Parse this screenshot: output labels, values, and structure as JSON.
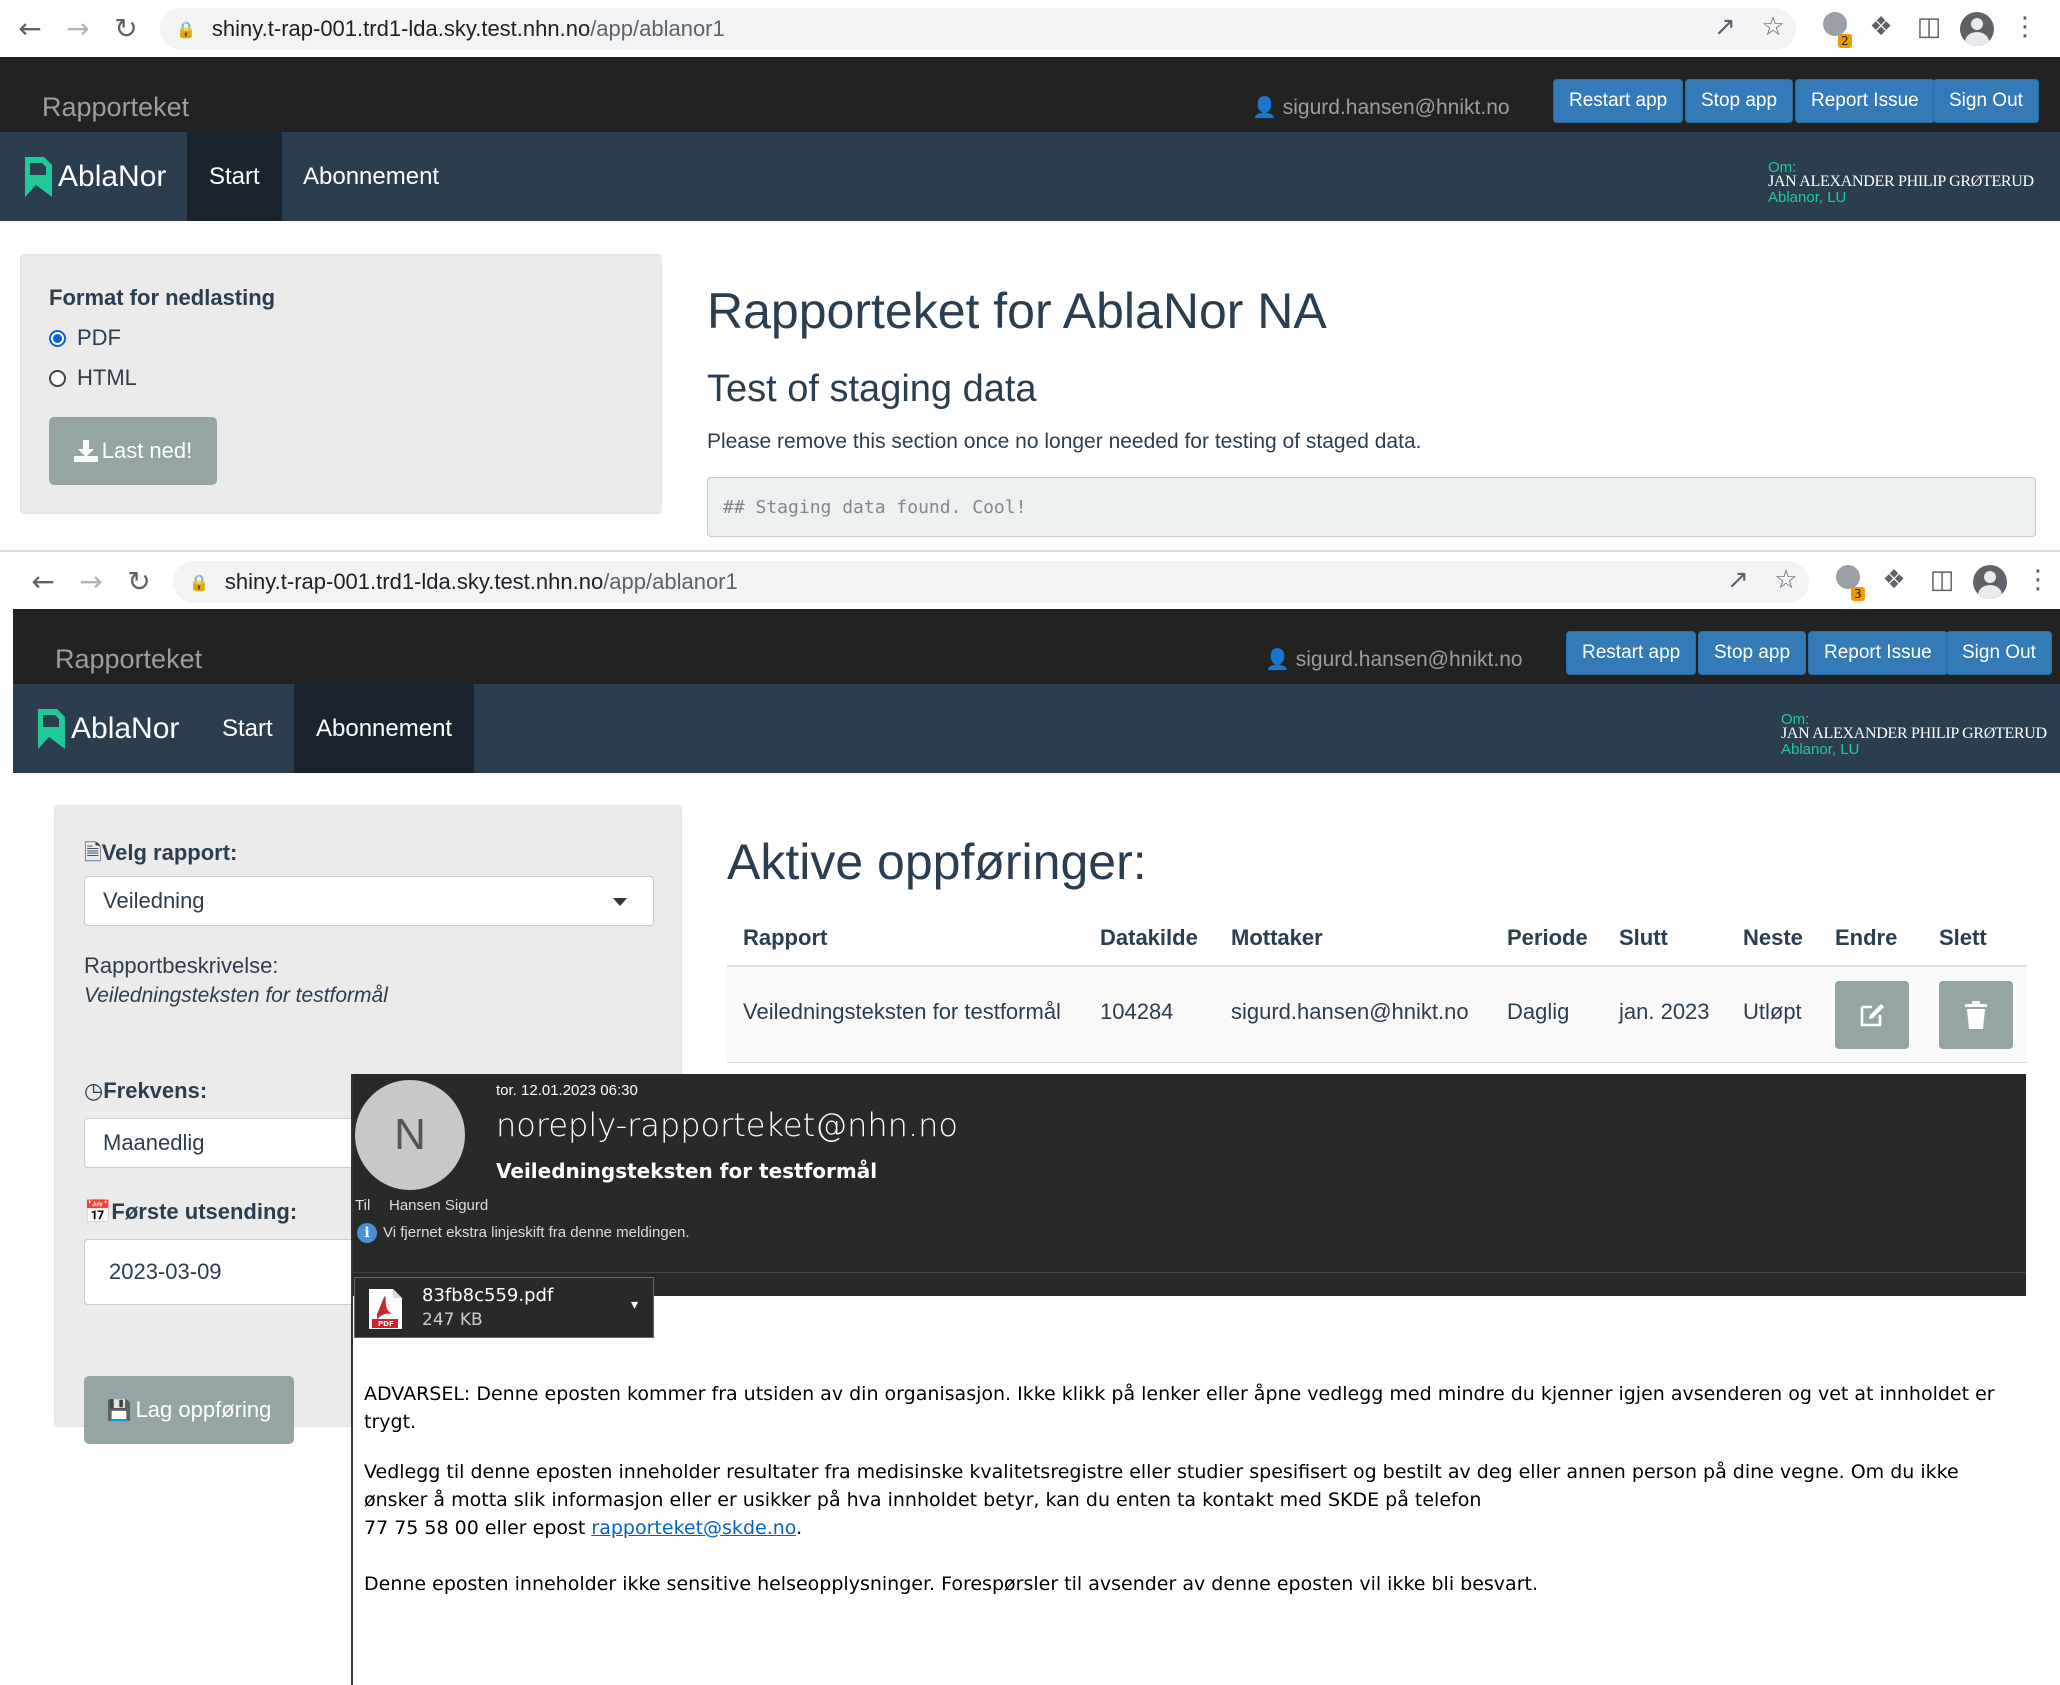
{
  "browser1": {
    "url_host": "shiny.t-rap-001.trd1-lda.sky.test.nhn.no",
    "url_path": "/app/ablanor1",
    "ext_badge": "2"
  },
  "browser2": {
    "url_host": "shiny.t-rap-001.trd1-lda.sky.test.nhn.no",
    "url_path": "/app/ablanor1",
    "ext_badge": "3"
  },
  "topbar": {
    "brand": "Rapporteket",
    "user": "sigurd.hansen@hnikt.no",
    "buttons": [
      "Restart app",
      "Stop app",
      "Report Issue",
      "Sign Out"
    ]
  },
  "appnav": {
    "app_name": "AblaNor",
    "tabs": [
      "Start",
      "Abonnement"
    ],
    "om_label": "Om:",
    "user_name": "JAN ALEXANDER PHILIP GRØTERUD",
    "org": "Ablanor, LU"
  },
  "start": {
    "format_label": "Format for nedlasting",
    "options": [
      "PDF",
      "HTML"
    ],
    "selected": "PDF",
    "download_button": "Last ned!",
    "title": "Rapporteket for AblaNor NA",
    "subtitle": "Test of staging data",
    "paragraph": "Please remove this section once no longer needed for testing of staged data.",
    "code": "## Staging data found. Cool!"
  },
  "abonnement": {
    "velg_label": "Velg rapport:",
    "velg_value": "Veiledning",
    "desc_label": "Rapportbeskrivelse:",
    "desc_value": "Veiledningsteksten for testformål",
    "freq_label": "Frekvens:",
    "freq_value": "Maanedlig",
    "first_label": "Første utsending:",
    "first_value": "2023-03-09",
    "create_button": "Lag oppføring",
    "table_title": "Aktive oppføringer:",
    "columns": [
      "Rapport",
      "Datakilde",
      "Mottaker",
      "Periode",
      "Slutt",
      "Neste",
      "Endre",
      "Slett"
    ],
    "rows": [
      {
        "rapport": "Veiledningsteksten for testformål",
        "datakilde": "104284",
        "mottaker": "sigurd.hansen@hnikt.no",
        "periode": "Daglig",
        "slutt": "jan. 2023",
        "neste": "Utløpt"
      }
    ]
  },
  "email": {
    "avatar_letter": "N",
    "date": "tor. 12.01.2023 06:30",
    "from": "noreply-rapporteket@nhn.no",
    "subject": "Veiledningsteksten for testformål",
    "to_label": "Til",
    "to": "Hansen Sigurd",
    "info": "Vi fjernet ekstra linjeskift fra denne meldingen.",
    "attachment_name": "83fb8c559.pdf",
    "attachment_size": "247 KB",
    "pdf_label": "PDF",
    "warning": "ADVARSEL: Denne eposten kommer fra utsiden av din organisasjon. Ikke klikk på lenker eller åpne vedlegg med mindre du kjenner igjen avsenderen og vet at innholdet er trygt.",
    "body1": "Vedlegg til denne eposten inneholder resultater fra medisinske kvalitetsregistre eller studier spesifisert og bestilt av deg eller annen person på dine vegne. Om du ikke ønsker å motta slik informasjon eller er usikker på hva innholdet betyr, kan du enten ta kontakt med SKDE på telefon",
    "body2_prefix": "77 75 58 00 eller epost ",
    "body2_link": "rapporteket@skde.no",
    "body2_suffix": ".",
    "body3": "Denne eposten inneholder ikke sensitive helseopplysninger. Forespørsler til avsender av denne eposten vil ikke bli besvart."
  },
  "colors": {
    "navbar_dark": "#222222",
    "app_nav": "#2b3e50",
    "primary_button": "#337ab7",
    "grey_button": "#95a5a6",
    "accent_teal": "#20c997"
  },
  "icons": [
    "back-icon",
    "forward-icon",
    "reload-icon",
    "lock-icon",
    "share-icon",
    "star-icon",
    "extension-icon",
    "puzzle-icon",
    "sidepanel-icon",
    "profile-icon",
    "menu-icon",
    "user-icon",
    "download-icon",
    "file-icon",
    "clock-icon",
    "calendar-icon",
    "save-icon",
    "edit-icon",
    "trash-icon",
    "info-icon",
    "pdf-icon",
    "chevron-down-icon"
  ]
}
